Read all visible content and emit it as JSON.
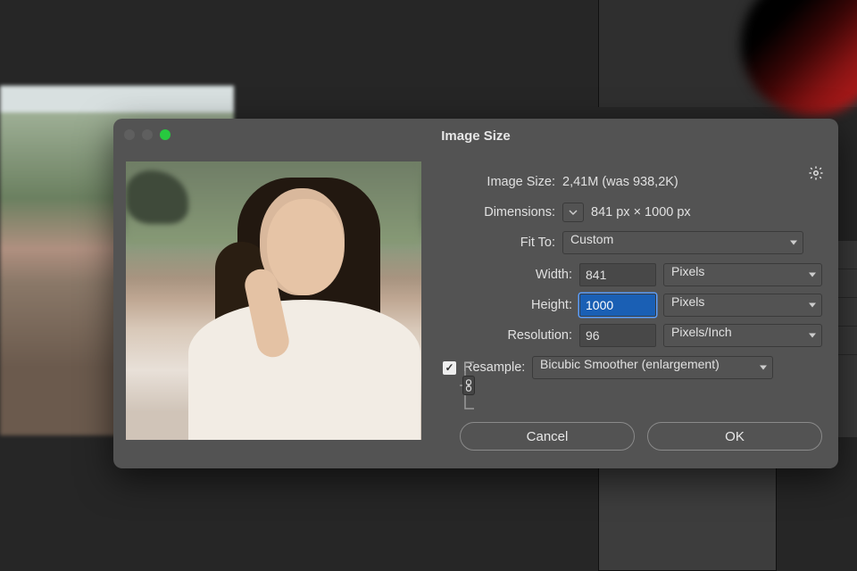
{
  "dialog": {
    "title": "Image Size",
    "labels": {
      "image_size": "Image Size:",
      "dimensions": "Dimensions:",
      "fit_to": "Fit To:",
      "width": "Width:",
      "height": "Height:",
      "resolution": "Resolution:",
      "resample": "Resample:"
    },
    "image_size_value": "2,41M (was 938,2K)",
    "dimensions_value": "841 px  ×  1000 px",
    "fit_to": "Custom",
    "width": "841",
    "width_unit": "Pixels",
    "height": "1000",
    "height_unit": "Pixels",
    "resolution": "96",
    "resolution_unit": "Pixels/Inch",
    "resample_checked": true,
    "resample_method": "Bicubic Smoother (enlargement)",
    "buttons": {
      "cancel": "Cancel",
      "ok": "OK"
    }
  }
}
